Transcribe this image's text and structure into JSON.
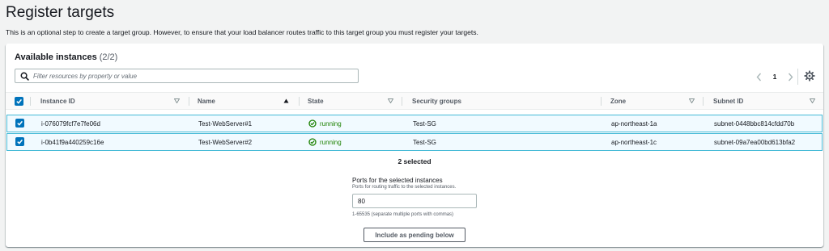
{
  "header": {
    "title": "Register targets",
    "description": "This is an optional step to create a target group. However, to ensure that your load balancer routes traffic to this target group you must register your targets."
  },
  "panel": {
    "title": "Available instances",
    "count": "(2/2)",
    "search": {
      "placeholder": "Filter resources by property or value",
      "value": ""
    },
    "pagination": {
      "current_page": "1"
    }
  },
  "table": {
    "columns": [
      "Instance ID",
      "Name",
      "State",
      "Security groups",
      "Zone",
      "Subnet ID"
    ],
    "sorted_column": "Name",
    "rows": [
      {
        "selected": true,
        "instance_id": "i-076079fcf7e7fe06d",
        "name": "Test-WebServer#1",
        "state": "running",
        "security_groups": "Test-SG",
        "zone": "ap-northeast-1a",
        "subnet_id": "subnet-0448bbc814cfdd70b"
      },
      {
        "selected": true,
        "instance_id": "i-0b41f9a440259c16e",
        "name": "Test-WebServer#2",
        "state": "running",
        "security_groups": "Test-SG",
        "zone": "ap-northeast-1c",
        "subnet_id": "subnet-09a7ea00bd613bfa2"
      }
    ]
  },
  "selection": {
    "summary": "2 selected",
    "ports_label": "Ports for the selected instances",
    "ports_help": "Ports for routing traffic to the selected instances.",
    "ports_value": "80",
    "ports_constraint": "1-65535 (separate multiple ports with commas)",
    "include_button": "Include as pending below"
  },
  "colors": {
    "accent": "#0073bb",
    "running": "#1d8102",
    "selected_row_bg": "#f1faff",
    "selected_row_border": "#44b9d6"
  },
  "icons": [
    "search-icon",
    "chevron-left-icon",
    "chevron-right-icon",
    "gear-icon",
    "checkbox-checked-icon",
    "sort-ascending-icon",
    "sort-desc-icon",
    "status-running-icon"
  ]
}
